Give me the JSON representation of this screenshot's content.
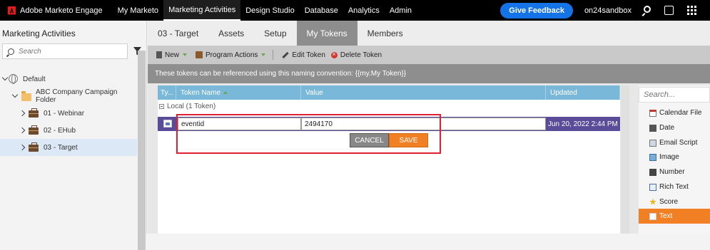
{
  "topnav": {
    "app_name": "Adobe Marketo Engage",
    "links": [
      "My Marketo",
      "Marketing Activities",
      "Design Studio",
      "Database",
      "Analytics",
      "Admin"
    ],
    "active_link": "Marketing Activities",
    "feedback_button": "Give Feedback",
    "workspace": "on24sandbox"
  },
  "sidebar": {
    "title": "Marketing Activities",
    "search_placeholder": "Search",
    "tree": [
      {
        "label": "Default",
        "icon": "globe-icon",
        "expanded": true
      },
      {
        "label": "ABC Company Campaign Folder",
        "icon": "folder-icon",
        "expanded": true
      },
      {
        "label": "01 - Webinar",
        "icon": "briefcase-icon",
        "expanded": false
      },
      {
        "label": "02 - EHub",
        "icon": "briefcase-icon",
        "expanded": false
      },
      {
        "label": "03 - Target",
        "icon": "briefcase-icon",
        "expanded": false,
        "selected": true
      }
    ]
  },
  "tabs": [
    "03 - Target",
    "Assets",
    "Setup",
    "My Tokens",
    "Members"
  ],
  "active_tab": "My Tokens",
  "toolbar": {
    "new": "New",
    "program_actions": "Program Actions",
    "edit_token": "Edit Token",
    "delete_token": "Delete Token"
  },
  "convention_text": "These tokens can be referenced using this naming convention: {{my.My Token}}",
  "grid": {
    "columns": [
      "Ty...",
      "Token Name",
      "Value",
      "Updated"
    ],
    "group_label": "Local (1 Token)",
    "editing_row": {
      "token_name": "eventid",
      "value": "2494170",
      "updated": "Jun 20, 2022 2:44 PM"
    },
    "cancel": "CANCEL",
    "save": "SAVE"
  },
  "token_types": {
    "search_placeholder": "Search...",
    "items": [
      {
        "label": "Calendar File",
        "icon": "calendar-icon"
      },
      {
        "label": "Date",
        "icon": "date-icon"
      },
      {
        "label": "Email Script",
        "icon": "email-script-icon"
      },
      {
        "label": "Image",
        "icon": "image-icon"
      },
      {
        "label": "Number",
        "icon": "number-icon"
      },
      {
        "label": "Rich Text",
        "icon": "rich-text-icon"
      },
      {
        "label": "Score",
        "icon": "star-icon"
      },
      {
        "label": "Text",
        "icon": "text-icon",
        "selected": true
      }
    ]
  },
  "colors": {
    "accent_blue": "#1473e6",
    "grid_header": "#7ab8d9",
    "edit_row": "#5a4c99",
    "save_orange": "#f08023",
    "highlight_red": "#e02030"
  }
}
